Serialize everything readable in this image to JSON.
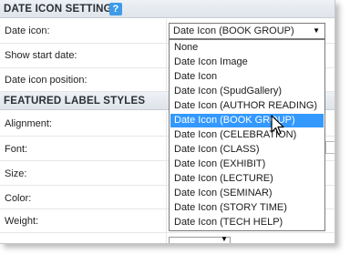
{
  "sections": {
    "date_icon_settings": "DATE ICON SETTINGS",
    "featured_label_styles": "FEATURED LABEL STYLES"
  },
  "help_icon": "?",
  "fields": {
    "date_icon": "Date icon:",
    "show_start_date": "Show start date:",
    "date_icon_position": "Date icon position:",
    "alignment": "Alignment:",
    "font": "Font:",
    "size": "Size:",
    "color": "Color:",
    "weight": "Weight:"
  },
  "date_icon_select": {
    "value": "Date Icon (BOOK GROUP)",
    "arrow": "▼"
  },
  "dropdown_options": [
    "None",
    "Date Icon Image",
    "Date Icon",
    "Date Icon (SpudGallery)",
    "Date Icon (AUTHOR READING)",
    "Date Icon (BOOK GROUP)",
    "Date Icon (CELEBRATION)",
    "Date Icon (CLASS)",
    "Date Icon (EXHIBIT)",
    "Date Icon (LECTURE)",
    "Date Icon (SEMINAR)",
    "Date Icon (STORY TIME)",
    "Date Icon (TECH HELP)"
  ],
  "selected_option_index": 5,
  "colors": {
    "header_bg": "#dfe4ea",
    "help_icon": "#3d9be9",
    "selected_option_bg": "#3399ff"
  }
}
